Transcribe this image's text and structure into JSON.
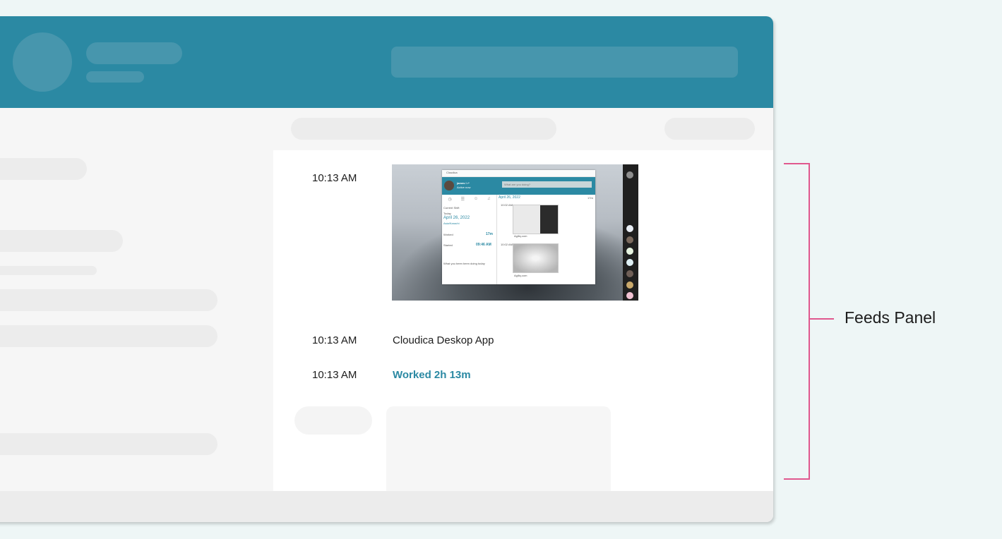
{
  "feed": {
    "entries": [
      {
        "time": "10:13 AM"
      },
      {
        "time": "10:13 AM",
        "text": "Cloudica Deskop App"
      },
      {
        "time": "10:13 AM",
        "text": "Worked 2h 13m"
      }
    ],
    "screenshot": {
      "app_title": "Cloudica",
      "user_name": "james l •*",
      "user_status": "Active now",
      "search_placeholder": "What are you doing?",
      "current_shift": "Current Shift",
      "today_label": "Today",
      "date": "April 26, 2022",
      "timezone": "Asia/Karachi",
      "worked_label": "Worked",
      "worked_value": "17m",
      "started_label": "Started",
      "started_value": "09:46 AM",
      "prompt": "What you been been doing today",
      "main_date": "April 26, 2022",
      "main_total": "17m",
      "row1_time": "10:02 AM",
      "row1_caption": "Agiliq.com",
      "row2_time": "10:02 AM",
      "row2_caption": "Agiliq.com"
    }
  },
  "annotation": {
    "label": "Feeds Panel"
  },
  "colors": {
    "brand": "#2b89a3",
    "accent": "#e0588e"
  }
}
